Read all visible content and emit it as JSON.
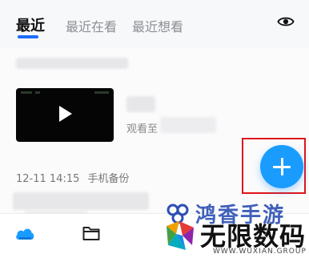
{
  "tabs": [
    {
      "label": "最近",
      "active": true
    },
    {
      "label": "最近在看",
      "active": false
    },
    {
      "label": "最近想看",
      "active": false
    }
  ],
  "colors": {
    "accent": "#1b6dff",
    "fab": "#1a9cff",
    "highlight_frame": "#e0141b"
  },
  "recent_video": {
    "watched_prefix": "观看至"
  },
  "section": {
    "date": "12-11 14:15",
    "title": "手机备份"
  },
  "fab": {
    "icon": "plus-icon"
  },
  "bottom_nav": {
    "items": [
      {
        "icon": "cloud-icon",
        "active": true
      },
      {
        "icon": "folder-icon",
        "active": false
      }
    ]
  },
  "watermark": {
    "top_text": "鸿香手游",
    "main_text": "无限数码",
    "url_text": "WWW.WUXIAN.GROUP"
  }
}
